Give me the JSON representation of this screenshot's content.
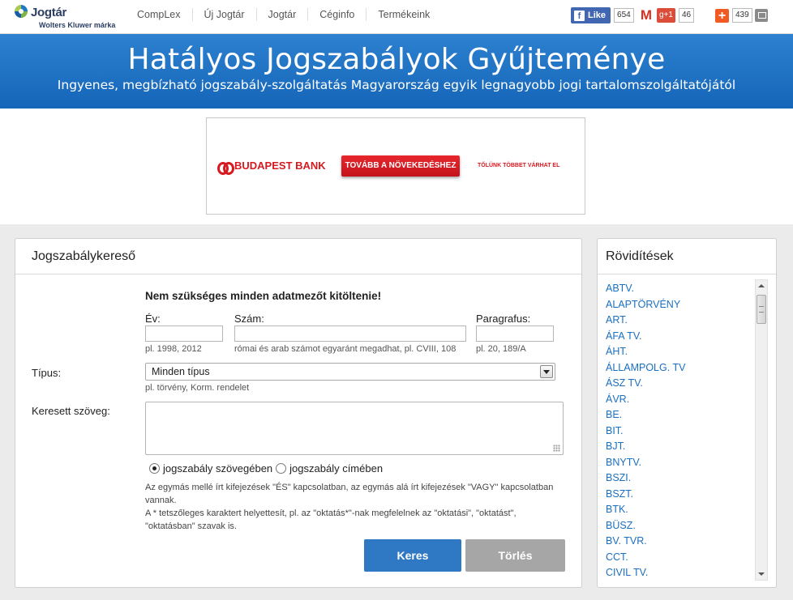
{
  "logo": {
    "name": "Jogtár",
    "sub": "Wolters Kluwer márka"
  },
  "nav": [
    "CompLex",
    "Új Jogtár",
    "Jogtár",
    "Céginfo",
    "Termékeink"
  ],
  "social": {
    "fb_label": "Like",
    "fb_count": "654",
    "gplus_label": "g+1",
    "gplus_count": "46",
    "share_count": "439"
  },
  "banner": {
    "title": "Hatályos Jogszabályok Gyűjteménye",
    "subtitle": "Ingyenes, megbízható jogszabály-szolgáltatás Magyarország egyik legnagyobb jogi tartalomszolgáltatójától"
  },
  "ad": {
    "brand": "BUDAPEST BANK",
    "cta": "TOVÁBB A NÖVEKEDÉSHEZ",
    "tagline": "TŐLÜNK TÖBBET VÁRHAT EL"
  },
  "search": {
    "title": "Jogszabálykereső",
    "hint": "Nem szükséges minden adatmezőt kitöltenie!",
    "year_label": "Év:",
    "year_example": "pl. 1998, 2012",
    "number_label": "Szám:",
    "number_example": "római és arab számot egyaránt megadhat, pl. CVIII, 108",
    "paragraph_label": "Paragrafus:",
    "paragraph_example": "pl. 20, 189/A",
    "type_label": "Típus:",
    "type_value": "Minden típus",
    "type_example": "pl. törvény, Korm. rendelet",
    "text_label": "Keresett szöveg:",
    "radio_body": "jogszabály szövegében",
    "radio_title": "jogszabály címében",
    "note1": "Az egymás mellé írt kifejezések \"ÉS\" kapcsolatban, az egymás alá írt kifejezések \"VAGY\" kapcsolatban vannak.",
    "note2": "A * tetszőleges karaktert helyettesít, pl. az \"oktatás*\"-nak megfelelnek az \"oktatási\", \"oktatást\", \"oktatásban\" szavak is.",
    "search_button": "Keres",
    "clear_button": "Törlés"
  },
  "abbreviations": {
    "title": "Rövidítések",
    "items": [
      "ABTV.",
      "ALAPTÖRVÉNY",
      "ART.",
      "ÁFA TV.",
      "ÁHT.",
      "ÁLLAMPOLG. TV",
      "ÁSZ TV.",
      "ÁVR.",
      "BE.",
      "BIT.",
      "BJT.",
      "BNYTV.",
      "BSZI.",
      "BSZT.",
      "BTK.",
      "BÜSZ.",
      "BV. TVR.",
      "CCT.",
      "CIVIL TV."
    ]
  }
}
